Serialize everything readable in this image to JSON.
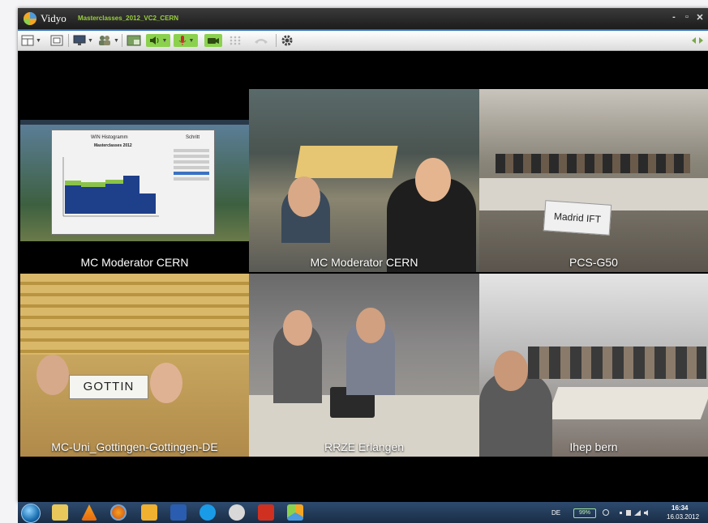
{
  "window": {
    "app_name": "Vidyo",
    "conference_name": "Masterclasses_2012_VC2_CERN",
    "controls": [
      "-",
      "▫",
      "✕"
    ]
  },
  "toolbar": {
    "buttons": [
      {
        "name": "layout-button",
        "icon": "grid-icon"
      },
      {
        "name": "fullscreen-button",
        "icon": "fullscreen-icon"
      },
      {
        "name": "share-button",
        "icon": "monitor-icon"
      },
      {
        "name": "contacts-button",
        "icon": "people-icon"
      },
      {
        "name": "self-view-button",
        "icon": "selfview-icon"
      },
      {
        "name": "speaker-button",
        "icon": "speaker-icon"
      },
      {
        "name": "microphone-button",
        "icon": "microphone-icon"
      },
      {
        "name": "camera-button",
        "icon": "camera-icon"
      },
      {
        "name": "dialpad-button",
        "icon": "dialpad-icon"
      },
      {
        "name": "hangup-button",
        "icon": "hangup-icon"
      },
      {
        "name": "settings-button",
        "icon": "gear-icon"
      }
    ]
  },
  "tiles": [
    {
      "label": "MC Moderator CERN"
    },
    {
      "label": "MC Moderator CERN"
    },
    {
      "label": "PCS-G50"
    },
    {
      "label": "MC-Uni_Gottingen-Gottingen-DE"
    },
    {
      "label": "RRZE Erlangen"
    },
    {
      "label": "Ihep bern"
    }
  ],
  "shared_screen": {
    "chart_title": "WIN Histogramm",
    "chart_subtitle": "Masterclasses 2012",
    "side_title": "Schritt"
  },
  "signs": {
    "madrid": "Madrid IFT",
    "gottin": "GOTTIN"
  },
  "taskbar": {
    "language": "DE",
    "battery": "99%",
    "time": "16:34",
    "date": "16.03.2012"
  },
  "colors": {
    "accent_blue": "#2b6fb8",
    "toolbar_green": "#8bd14e",
    "conf_name_green": "#9ad03a"
  }
}
